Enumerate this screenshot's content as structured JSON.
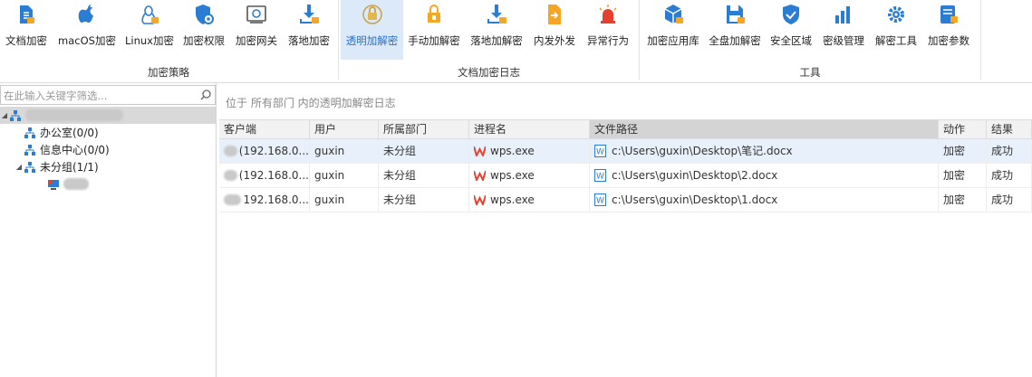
{
  "ribbon": {
    "groups": [
      {
        "title": "加密策略",
        "buttons": [
          {
            "label": "文档加密",
            "icon": "document-lock-icon"
          },
          {
            "label": "macOS加密",
            "icon": "apple-icon"
          },
          {
            "label": "Linux加密",
            "icon": "linux-icon"
          },
          {
            "label": "加密权限",
            "icon": "shield-gear-icon"
          },
          {
            "label": "加密网关",
            "icon": "gateway-icon"
          },
          {
            "label": "落地加密",
            "icon": "download-lock-icon"
          }
        ]
      },
      {
        "title": "文档加密日志",
        "buttons": [
          {
            "label": "透明加解密",
            "icon": "transparent-lock-icon",
            "active": true
          },
          {
            "label": "手动加解密",
            "icon": "manual-lock-icon"
          },
          {
            "label": "落地加解密",
            "icon": "download-lock-icon"
          },
          {
            "label": "内发外发",
            "icon": "send-file-icon"
          },
          {
            "label": "异常行为",
            "icon": "alarm-icon"
          }
        ]
      },
      {
        "title": "工具",
        "buttons": [
          {
            "label": "加密应用库",
            "icon": "app-library-icon"
          },
          {
            "label": "全盘加解密",
            "icon": "disk-save-icon"
          },
          {
            "label": "安全区域",
            "icon": "shield-check-icon"
          },
          {
            "label": "密级管理",
            "icon": "level-chart-icon"
          },
          {
            "label": "解密工具",
            "icon": "gear-icon"
          },
          {
            "label": "加密参数",
            "icon": "param-lock-icon"
          }
        ]
      }
    ]
  },
  "search": {
    "placeholder": "在此输入关键字筛选..."
  },
  "tree": {
    "items": [
      {
        "label": "办公室(0/0)"
      },
      {
        "label": "信息中心(0/0)"
      },
      {
        "label": "未分组(1/1)"
      }
    ]
  },
  "location": {
    "text": "位于 所有部门 内的透明加解密日志"
  },
  "table": {
    "columns": [
      "客户端",
      "用户",
      "所属部门",
      "进程名",
      "文件路径",
      "动作",
      "结果"
    ],
    "rows": [
      {
        "client": "(192.168.0...",
        "user": "guxin",
        "dept": "未分组",
        "process": "wps.exe",
        "path": "c:\\Users\\guxin\\Desktop\\笔记.docx",
        "action": "加密",
        "result": "成功"
      },
      {
        "client": "(192.168.0...",
        "user": "guxin",
        "dept": "未分组",
        "process": "wps.exe",
        "path": "c:\\Users\\guxin\\Desktop\\2.docx",
        "action": "加密",
        "result": "成功"
      },
      {
        "client": "192.168.0...",
        "user": "guxin",
        "dept": "未分组",
        "process": "wps.exe",
        "path": "c:\\Users\\guxin\\Desktop\\1.docx",
        "action": "加密",
        "result": "成功"
      }
    ]
  },
  "colors": {
    "accent": "#1e6fd9",
    "icon_blue": "#2b7cd3",
    "active_bg": "#dbe9f8",
    "wps_red": "#e8402f"
  }
}
